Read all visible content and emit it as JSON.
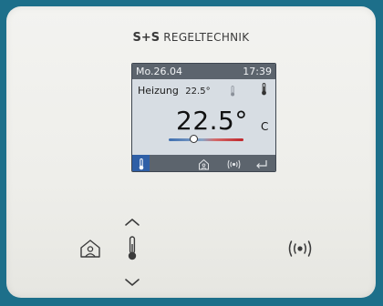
{
  "brand": {
    "prefix": "S+S",
    "name": "REGELTECHNIK"
  },
  "screen": {
    "date": "Mo.26.04",
    "time": "17:39",
    "mode_label": "Heizung",
    "setpoint": "22.5°",
    "temperature": "22.5°",
    "unit": "C",
    "slider_position": 0.34
  },
  "colors": {
    "background": "#1d6f8a",
    "panel": "#f0f0ec",
    "screen": "#d7dde3",
    "status_bar": "#5c646d",
    "selected_tab": "#2f5fa6",
    "cold": "#3f6fb0",
    "hot": "#c0262b"
  },
  "icons": {
    "screen_bottom": [
      "thermometer-icon",
      "home-icon",
      "wireless-icon",
      "return-icon"
    ],
    "panel_buttons": [
      "home-icon",
      "chevron-up-icon",
      "thermometer-icon",
      "chevron-down-icon",
      "wireless-icon"
    ]
  }
}
